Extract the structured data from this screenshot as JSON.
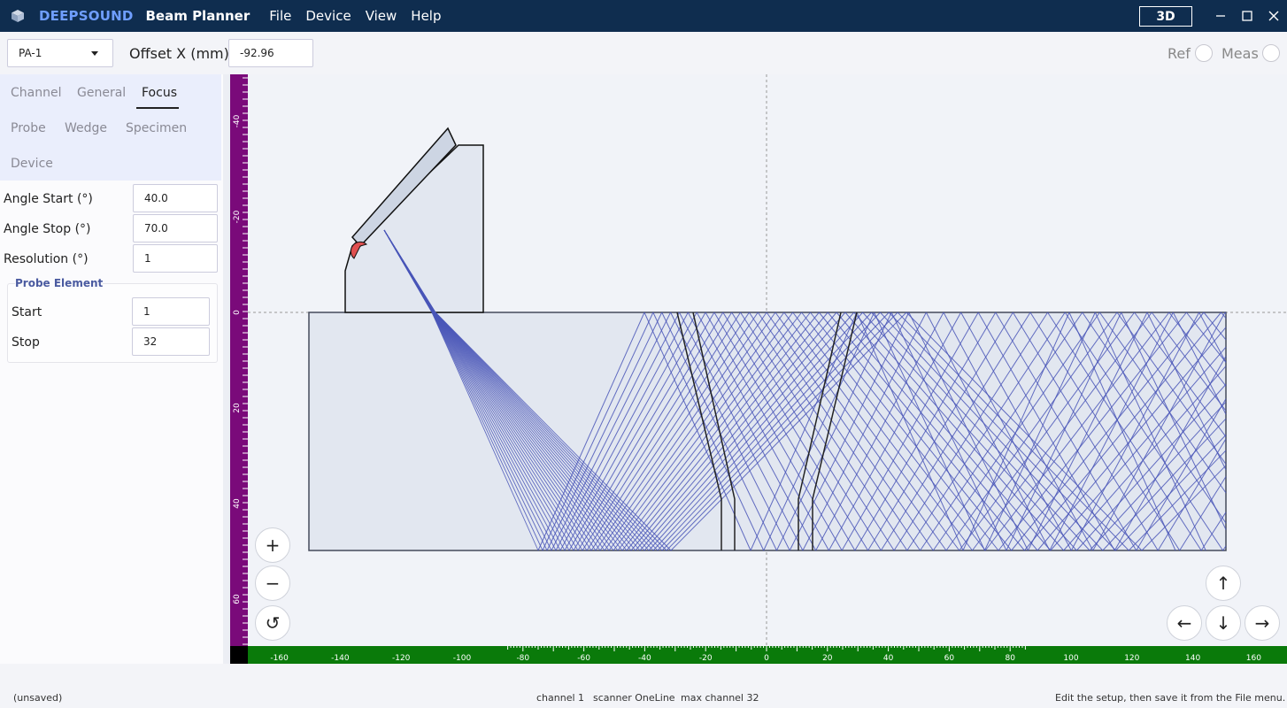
{
  "titlebar": {
    "brand": "DEEPSOUND",
    "app_title": "Beam Planner",
    "menu": [
      "File",
      "Device",
      "View",
      "Help"
    ],
    "view_3d_label": "3D"
  },
  "toolbar": {
    "probe_value": "PA-1",
    "offset_label": "Offset X (mm)",
    "offset_value": "-92.96",
    "ref_label": "Ref",
    "meas_label": "Meas"
  },
  "tabs": {
    "channel": "Channel",
    "general": "General",
    "focus": "Focus",
    "probe": "Probe",
    "wedge": "Wedge",
    "specimen": "Specimen",
    "device": "Device",
    "active": "Focus"
  },
  "focus": {
    "angle_start_label": "Angle Start (°)",
    "angle_start_value": "40.0",
    "angle_stop_label": "Angle Stop (°)",
    "angle_stop_value": "70.0",
    "resolution_label": "Resolution (°)",
    "resolution_value": "1",
    "probe_element": {
      "title": "Probe Element",
      "start_label": "Start",
      "start_value": "1",
      "stop_label": "Stop",
      "stop_value": "32"
    }
  },
  "ruler": {
    "x_ticks": [
      -160,
      -140,
      -120,
      -100,
      -80,
      -60,
      -40,
      -20,
      0,
      20,
      40,
      60,
      80,
      100,
      120,
      140,
      160
    ],
    "y_ticks": [
      -40,
      -20,
      0,
      20,
      40,
      60
    ],
    "x_color": "#0a7a0a",
    "y_color": "#7a0a7a"
  },
  "beam": {
    "angle_start": 40,
    "angle_stop": 70,
    "resolution": 1,
    "color": "#4a56b8"
  },
  "controls": {
    "zoom_in": "+",
    "zoom_out": "−",
    "reset": "↺",
    "up": "↑",
    "down": "↓",
    "left": "←",
    "right": "→"
  },
  "status": {
    "saved_state": "(unsaved)",
    "channel": "channel 1",
    "scanner": "scanner OneLine",
    "max_channel": "max channel 32",
    "hint": "Edit the setup, then save it from the File menu."
  }
}
